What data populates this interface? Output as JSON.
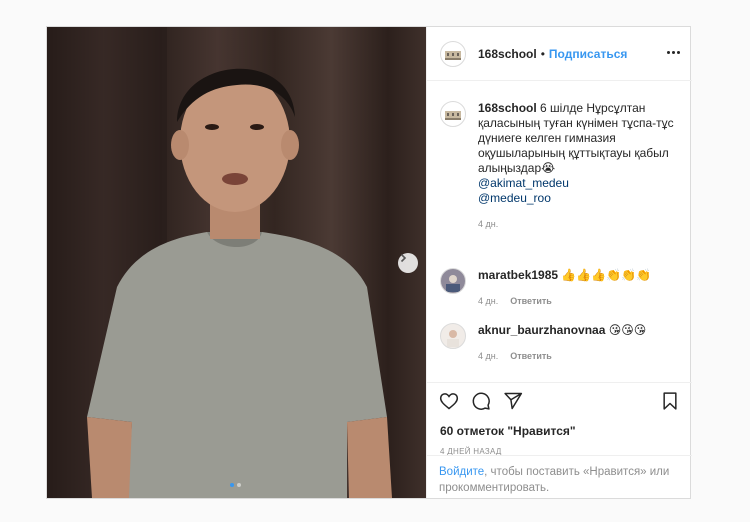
{
  "post": {
    "username": "168school",
    "separator": "•",
    "follow_label": "Подписаться",
    "caption": {
      "text": "6 шілде Нұрсұлтан қаласының туған күнімен тұспа-тұс дүниеге келген гимназия оқушыларының құттықтауы қабыл алыңыздар😭",
      "mentions": [
        "@akimat_medeu",
        "@medeu_roo"
      ],
      "time": "4 дн."
    },
    "comments": [
      {
        "username": "maratbek1985",
        "text": "👍👍👍👏👏👏",
        "time": "4 дн.",
        "reply_label": "Ответить"
      },
      {
        "username": "aknur_baurzhanovnaa",
        "text": "😘😘😘",
        "time": "4 дн.",
        "reply_label": "Ответить"
      }
    ],
    "likes_text": "60 отметок \"Нравится\"",
    "date_text": "4 ДНЕЙ НАЗАД",
    "login_link": "Войдите",
    "login_rest": ", чтобы поставить «Нравится» или прокомментировать.",
    "media_dots": {
      "count": 2,
      "active": 0
    },
    "icons": [
      "heart-icon",
      "comment-icon",
      "share-icon",
      "bookmark-icon",
      "more-icon",
      "chevron-right-icon"
    ]
  }
}
